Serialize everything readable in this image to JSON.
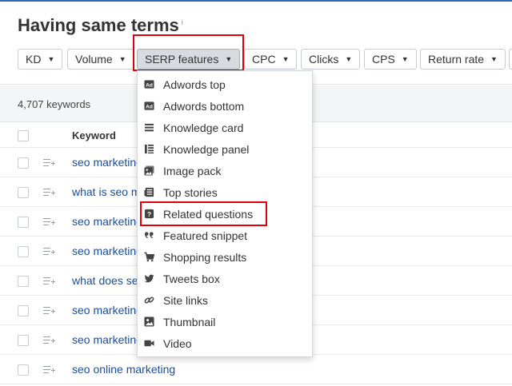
{
  "header": {
    "title": "Having same terms",
    "info_mark": "i"
  },
  "filters": [
    {
      "label": "KD",
      "caret": "▼"
    },
    {
      "label": "Volume",
      "caret": "▼"
    },
    {
      "label": "SERP features",
      "caret": "▼"
    },
    {
      "label": "CPC",
      "caret": "▼"
    },
    {
      "label": "Clicks",
      "caret": "▼"
    },
    {
      "label": "CPS",
      "caret": "▼"
    },
    {
      "label": "Return rate",
      "caret": "▼"
    }
  ],
  "results": {
    "count_text": "4,707 keywords"
  },
  "table": {
    "keyword_header": "Keyword",
    "rows": [
      {
        "keyword": "seo marketing"
      },
      {
        "keyword": "what is seo m"
      },
      {
        "keyword": "seo marketing"
      },
      {
        "keyword": "seo marketing"
      },
      {
        "keyword": "what does se"
      },
      {
        "keyword": "seo marketing"
      },
      {
        "keyword": "seo marketing"
      },
      {
        "keyword": "seo online marketing"
      }
    ]
  },
  "serp_menu": {
    "items": [
      {
        "label": "Adwords top",
        "icon": "ad-icon"
      },
      {
        "label": "Adwords bottom",
        "icon": "ad-icon"
      },
      {
        "label": "Knowledge card",
        "icon": "knowledge-card-icon"
      },
      {
        "label": "Knowledge panel",
        "icon": "knowledge-panel-icon"
      },
      {
        "label": "Image pack",
        "icon": "image-pack-icon"
      },
      {
        "label": "Top stories",
        "icon": "newspaper-icon"
      },
      {
        "label": "Related questions",
        "icon": "question-icon"
      },
      {
        "label": "Featured snippet",
        "icon": "quote-icon"
      },
      {
        "label": "Shopping results",
        "icon": "cart-icon"
      },
      {
        "label": "Tweets box",
        "icon": "twitter-icon"
      },
      {
        "label": "Site links",
        "icon": "link-icon"
      },
      {
        "label": "Thumbnail",
        "icon": "image-icon"
      },
      {
        "label": "Video",
        "icon": "video-icon"
      }
    ]
  },
  "colors": {
    "accent": "#2d6ab6",
    "link": "#1a4e9a",
    "highlight": "#e0000b",
    "active_filter": "#d7dbe0"
  }
}
